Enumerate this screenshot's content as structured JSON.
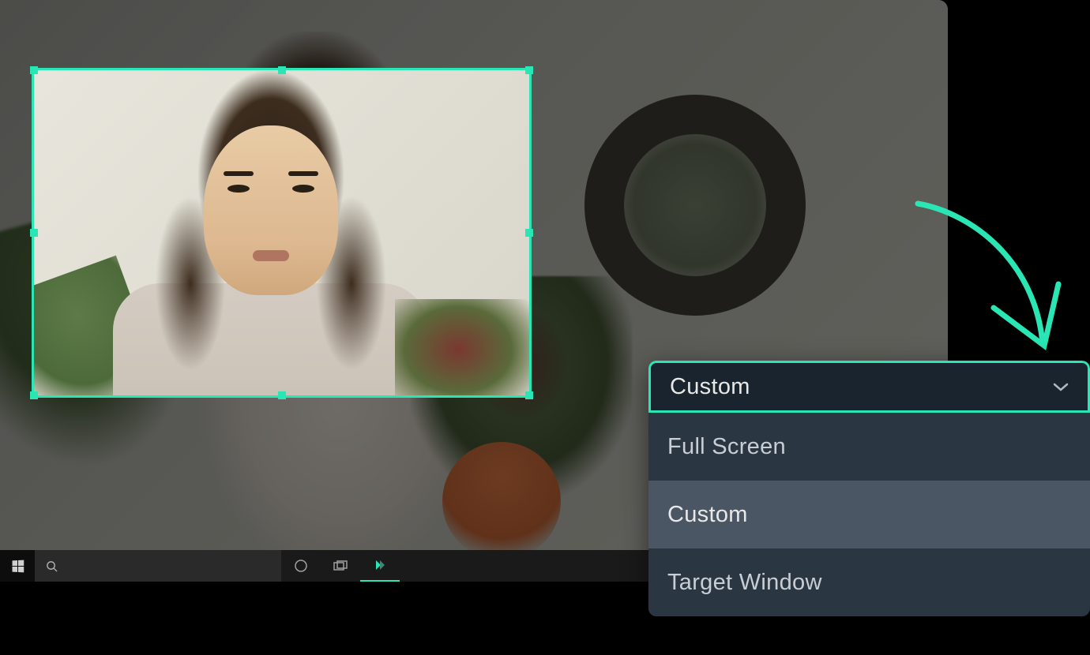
{
  "capture": {
    "selected_region_label": "selected-region"
  },
  "dropdown": {
    "selected": "Custom",
    "options": [
      {
        "label": "Full Screen",
        "highlighted": false
      },
      {
        "label": "Custom",
        "highlighted": true
      },
      {
        "label": "Target Window",
        "highlighted": false
      }
    ]
  },
  "colors": {
    "accent": "#2ae6b5",
    "dropdown_bg": "#2a3642",
    "dropdown_selected_bg": "#1a242e",
    "dropdown_highlight": "#4a5663"
  },
  "icons": {
    "chevron": "chevron-down-icon",
    "search": "search-icon",
    "windows": "windows-logo-icon",
    "cortana": "cortana-circle-icon",
    "taskview": "task-view-icon",
    "app": "filmora-icon"
  }
}
